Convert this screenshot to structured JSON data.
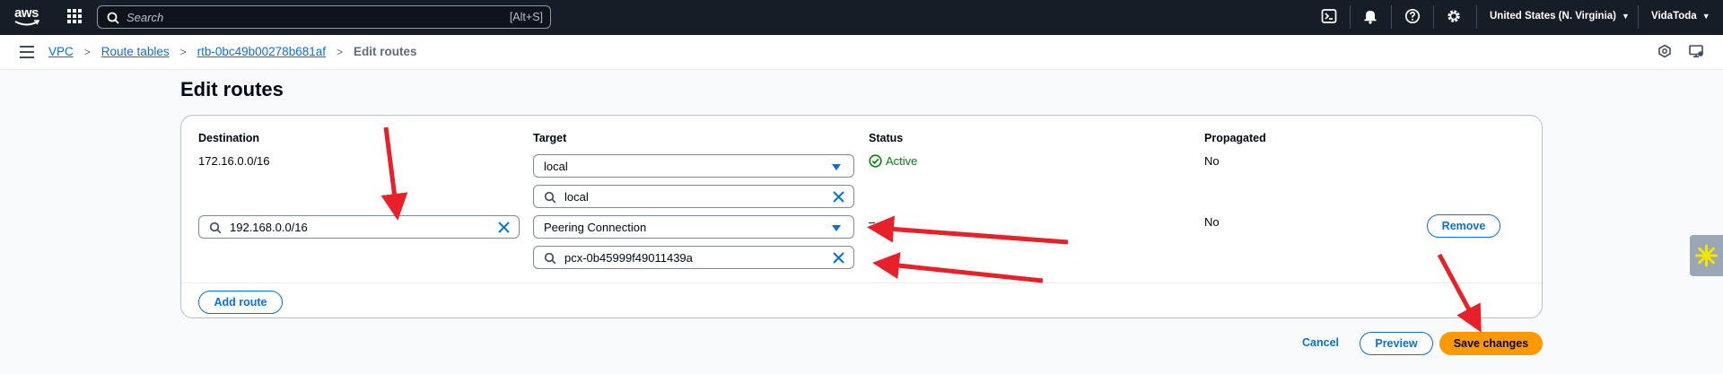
{
  "topbar": {
    "logo_text": "aws",
    "search": {
      "placeholder": "Search",
      "shortcut": "[Alt+S]"
    },
    "region": "United States (N. Virginia)",
    "account": "VidaToda",
    "icons": [
      "cloudshell-icon",
      "bell-icon",
      "help-icon",
      "settings-icon"
    ]
  },
  "breadcrumb": {
    "items": [
      "VPC",
      "Route tables",
      "rtb-0bc49b00278b681af"
    ],
    "current": "Edit routes"
  },
  "page": {
    "title": "Edit routes"
  },
  "table": {
    "columns": [
      "Destination",
      "Target",
      "Status",
      "Propagated"
    ],
    "rows": [
      {
        "destination": "172.16.0.0/16",
        "target_select": "local",
        "target_filter": "local",
        "status": "Active",
        "propagated": "No"
      },
      {
        "destination_input": "192.168.0.0/16",
        "target_select": "Peering Connection",
        "target_filter": "pcx-0b45999f49011439a",
        "status": "–",
        "propagated": "No",
        "remove_label": "Remove"
      }
    ],
    "add_route_label": "Add route"
  },
  "footer": {
    "cancel_label": "Cancel",
    "preview_label": "Preview",
    "save_label": "Save changes"
  },
  "colors": {
    "topbar_bg": "#161d26",
    "link_blue": "#0972d3",
    "primary_orange": "#ff9900",
    "success_green": "#037f0c",
    "annotation_red": "#e8202a"
  }
}
